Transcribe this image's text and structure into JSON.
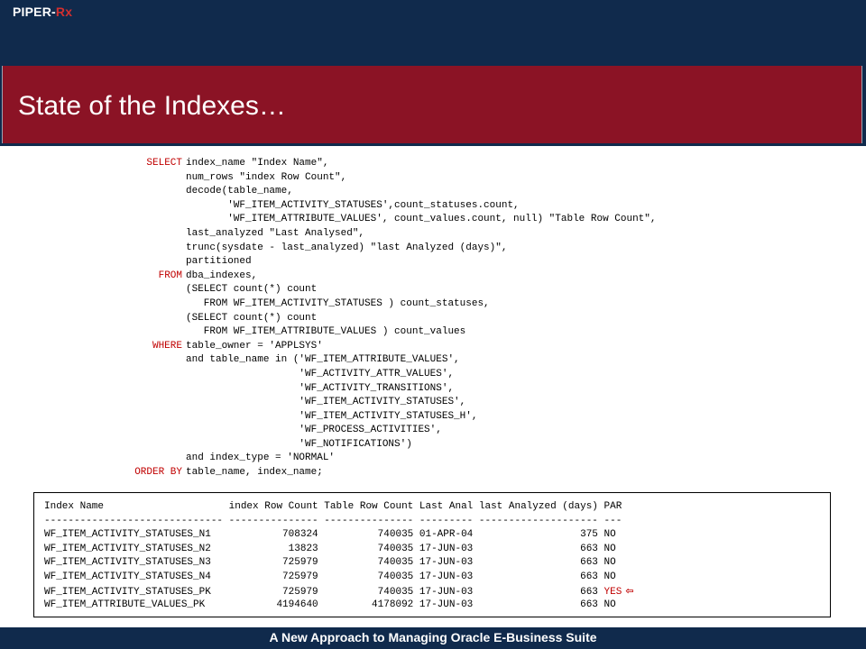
{
  "header": {
    "brand_main": "PIPER-",
    "brand_accent": "Rx",
    "title": "State of the Indexes…"
  },
  "sql": {
    "lines": [
      {
        "kw": "SELECT",
        "text": "index_name \"Index Name\","
      },
      {
        "kw": "",
        "text": "num_rows \"index Row Count\","
      },
      {
        "kw": "",
        "text": "decode(table_name,"
      },
      {
        "kw": "",
        "text": "       'WF_ITEM_ACTIVITY_STATUSES',count_statuses.count,"
      },
      {
        "kw": "",
        "text": "       'WF_ITEM_ATTRIBUTE_VALUES', count_values.count, null) \"Table Row Count\","
      },
      {
        "kw": "",
        "text": "last_analyzed \"Last Analysed\","
      },
      {
        "kw": "",
        "text": "trunc(sysdate - last_analyzed) \"last Analyzed (days)\","
      },
      {
        "kw": "",
        "text": "partitioned"
      },
      {
        "kw": "FROM",
        "text": "dba_indexes,"
      },
      {
        "kw": "",
        "text": "(SELECT count(*) count"
      },
      {
        "kw": "",
        "text": "   FROM WF_ITEM_ACTIVITY_STATUSES ) count_statuses,"
      },
      {
        "kw": "",
        "text": "(SELECT count(*) count"
      },
      {
        "kw": "",
        "text": "   FROM WF_ITEM_ATTRIBUTE_VALUES ) count_values"
      },
      {
        "kw": "WHERE",
        "text": "table_owner = 'APPLSYS'"
      },
      {
        "kw": "",
        "text": "and table_name in ('WF_ITEM_ATTRIBUTE_VALUES',"
      },
      {
        "kw": "",
        "text": "                   'WF_ACTIVITY_ATTR_VALUES',"
      },
      {
        "kw": "",
        "text": "                   'WF_ACTIVITY_TRANSITIONS',"
      },
      {
        "kw": "",
        "text": "                   'WF_ITEM_ACTIVITY_STATUSES',"
      },
      {
        "kw": "",
        "text": "                   'WF_ITEM_ACTIVITY_STATUSES_H',"
      },
      {
        "kw": "",
        "text": "                   'WF_PROCESS_ACTIVITIES',"
      },
      {
        "kw": "",
        "text": "                   'WF_NOTIFICATIONS')"
      },
      {
        "kw": "",
        "text": "and index_type = 'NORMAL'"
      },
      {
        "kw": "ORDER BY",
        "text": "table_name, index_name;"
      }
    ]
  },
  "results": {
    "header_line": "Index Name                     index Row Count Table Row Count Last Anal last Analyzed (days) PAR",
    "separator_line": "------------------------------ --------------- --------------- --------- -------------------- ---",
    "rows": [
      {
        "prefix": "WF_ITEM_ACTIVITY_STATUSES_N1            708324          740035 01-APR-04                  375 ",
        "par": "NO",
        "highlight": false
      },
      {
        "prefix": "WF_ITEM_ACTIVITY_STATUSES_N2             13823          740035 17-JUN-03                  663 ",
        "par": "NO",
        "highlight": false
      },
      {
        "prefix": "WF_ITEM_ACTIVITY_STATUSES_N3            725979          740035 17-JUN-03                  663 ",
        "par": "NO",
        "highlight": false
      },
      {
        "prefix": "WF_ITEM_ACTIVITY_STATUSES_N4            725979          740035 17-JUN-03                  663 ",
        "par": "NO",
        "highlight": false
      },
      {
        "prefix": "WF_ITEM_ACTIVITY_STATUSES_PK            725979          740035 17-JUN-03                  663 ",
        "par": "YES",
        "highlight": true
      },
      {
        "prefix": "WF_ITEM_ATTRIBUTE_VALUES_PK            4194640         4178092 17-JUN-03                  663 ",
        "par": "NO",
        "highlight": false
      }
    ],
    "arrow_glyph": "⇦"
  },
  "footer": {
    "text": "A New Approach to Managing Oracle E-Business Suite"
  },
  "colors": {
    "navy": "#102a4c",
    "title_red": "#8b1325",
    "keyword_red": "#c00000"
  }
}
